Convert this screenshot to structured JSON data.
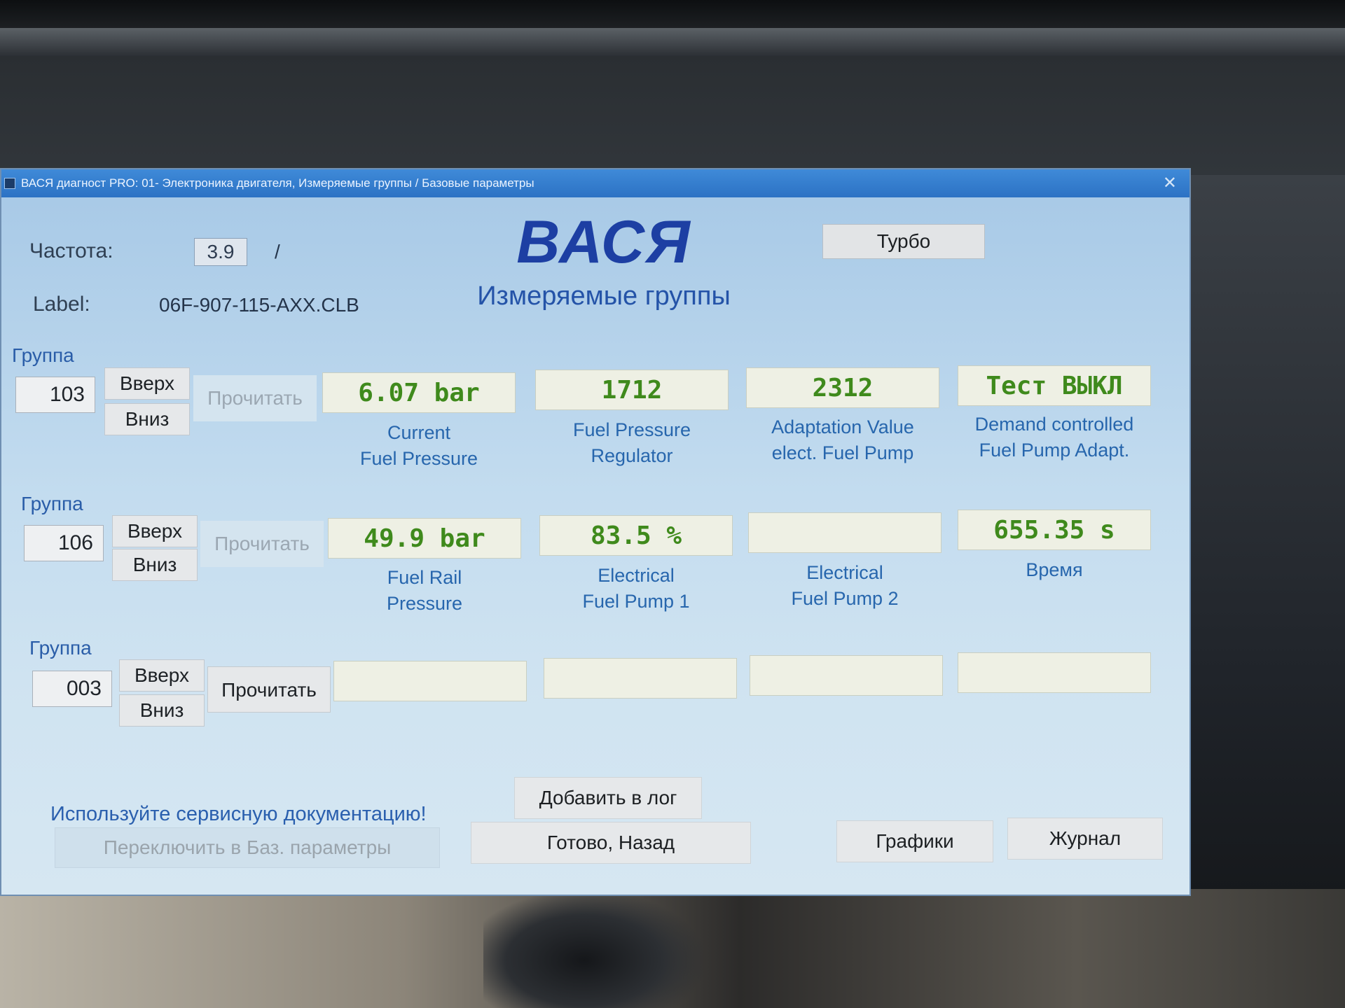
{
  "window": {
    "title": "ВАСЯ диагност PRO: 01- Электроника двигателя,  Измеряемые группы / Базовые параметры",
    "close_glyph": "✕"
  },
  "header": {
    "frequency_label": "Частота:",
    "frequency_value": "3.9",
    "frequency_separator": "/",
    "label_label": "Label:",
    "label_value": "06F-907-115-AXX.CLB",
    "brand": "ВАСЯ",
    "subtitle": "Измеряемые группы",
    "turbo_button": "Турбо"
  },
  "groups": [
    {
      "label": "Группа",
      "number": "103",
      "up": "Вверх",
      "down": "Вниз",
      "read": "Прочитать",
      "fields": [
        {
          "value": "6.07 bar",
          "label_line1": "Current",
          "label_line2": "Fuel Pressure"
        },
        {
          "value": "1712",
          "label_line1": "Fuel Pressure",
          "label_line2": "Regulator"
        },
        {
          "value": "2312",
          "label_line1": "Adaptation Value",
          "label_line2": "elect. Fuel Pump"
        },
        {
          "value": "Тест ВЫКЛ",
          "label_line1": "Demand controlled",
          "label_line2": "Fuel Pump Adapt."
        }
      ]
    },
    {
      "label": "Группа",
      "number": "106",
      "up": "Вверх",
      "down": "Вниз",
      "read": "Прочитать",
      "fields": [
        {
          "value": "49.9 bar",
          "label_line1": "Fuel Rail",
          "label_line2": "Pressure"
        },
        {
          "value": "83.5 %",
          "label_line1": "Electrical",
          "label_line2": "Fuel Pump 1"
        },
        {
          "value": "",
          "label_line1": "Electrical",
          "label_line2": "Fuel Pump 2"
        },
        {
          "value": "655.35 s",
          "label_line1": "Время",
          "label_line2": ""
        }
      ]
    },
    {
      "label": "Группа",
      "number": "003",
      "up": "Вверх",
      "down": "Вниз",
      "read": "Прочитать",
      "fields": [
        {
          "value": "",
          "label_line1": "",
          "label_line2": ""
        },
        {
          "value": "",
          "label_line1": "",
          "label_line2": ""
        },
        {
          "value": "",
          "label_line1": "",
          "label_line2": ""
        },
        {
          "value": "",
          "label_line1": "",
          "label_line2": ""
        }
      ]
    }
  ],
  "footer": {
    "note": "Используйте сервисную документацию!",
    "add_to_log": "Добавить в лог",
    "switch_basic": "Переключить в Баз. параметры",
    "done_back": "Готово, Назад",
    "graphs": "Графики",
    "journal": "Журнал"
  },
  "colors": {
    "value_green": "#3f8a1c",
    "label_blue": "#2766ad",
    "brand_blue": "#1d3fa3",
    "titlebar_blue": "#2c72c4"
  }
}
